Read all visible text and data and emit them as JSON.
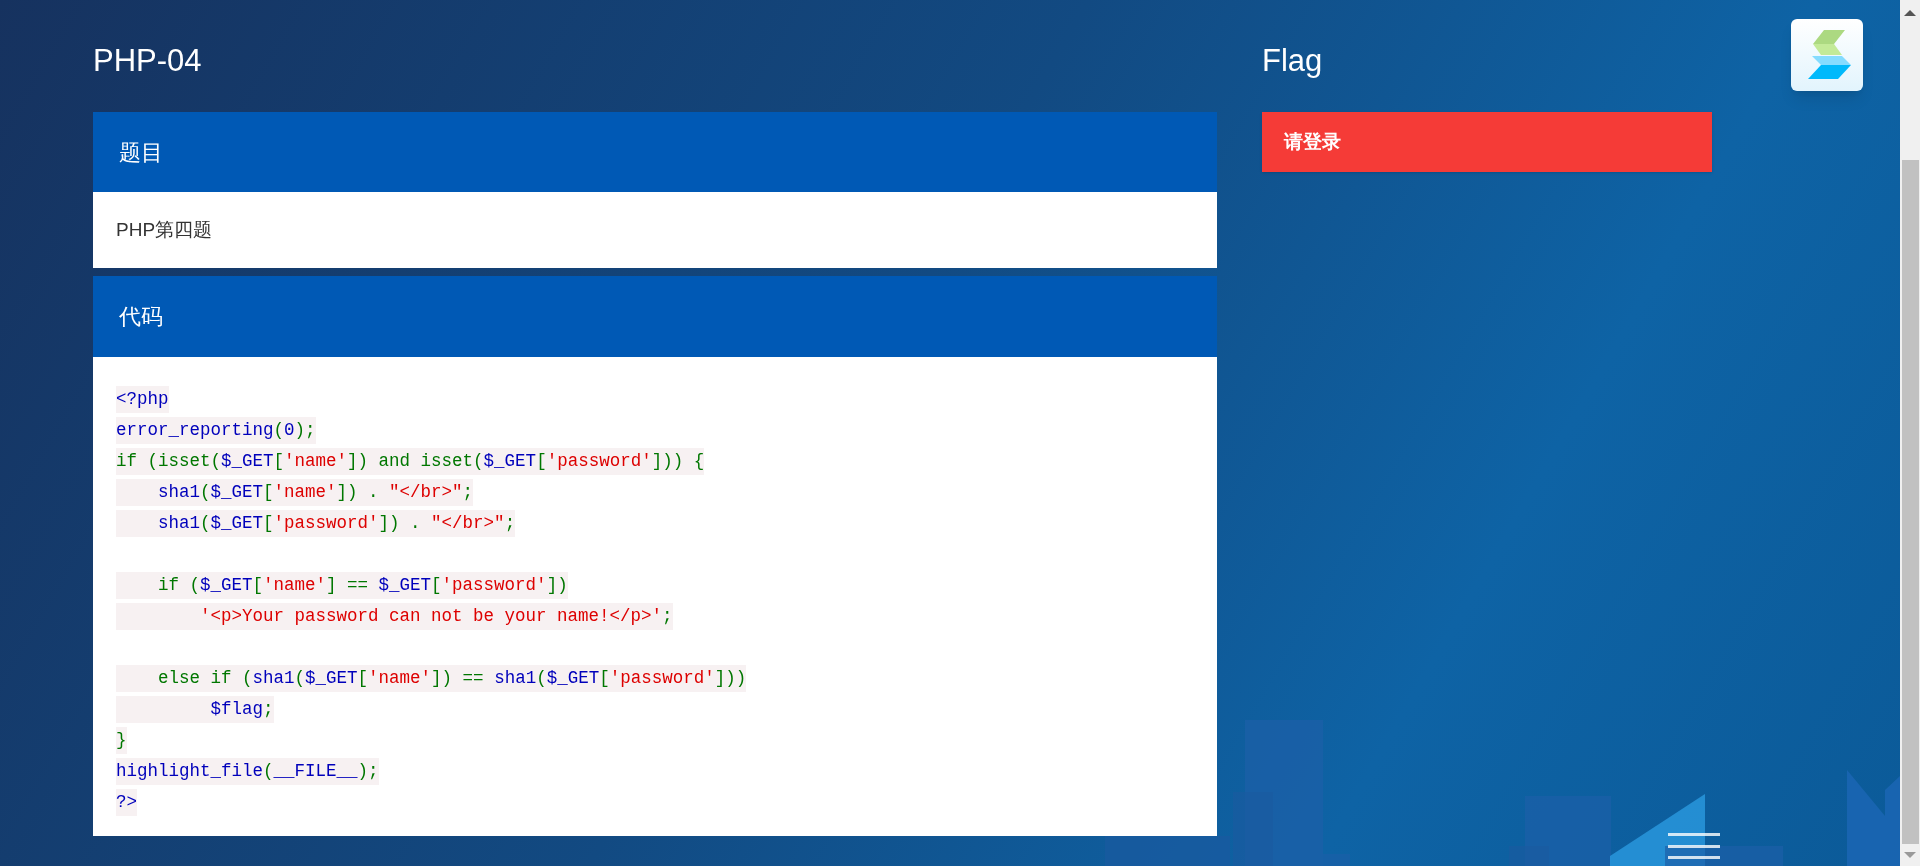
{
  "title": "PHP-04",
  "question": {
    "header": "题目",
    "body": "PHP第四题"
  },
  "code": {
    "header": "代码",
    "lines": [
      {
        "kind": "code",
        "tokens": [
          {
            "kind": "default",
            "text": "<?php"
          }
        ]
      },
      {
        "kind": "code",
        "tokens": [
          {
            "kind": "default",
            "text": "error_reporting"
          },
          {
            "kind": "keyword",
            "text": "("
          },
          {
            "kind": "default",
            "text": "0"
          },
          {
            "kind": "keyword",
            "text": ");"
          }
        ]
      },
      {
        "kind": "code",
        "tokens": [
          {
            "kind": "keyword",
            "text": "if (isset("
          },
          {
            "kind": "default",
            "text": "$_GET"
          },
          {
            "kind": "keyword",
            "text": "["
          },
          {
            "kind": "string",
            "text": "'name'"
          },
          {
            "kind": "keyword",
            "text": "]) and isset("
          },
          {
            "kind": "default",
            "text": "$_GET"
          },
          {
            "kind": "keyword",
            "text": "["
          },
          {
            "kind": "string",
            "text": "'password'"
          },
          {
            "kind": "keyword",
            "text": "])) {"
          }
        ]
      },
      {
        "kind": "code",
        "tokens": [
          {
            "kind": "default",
            "text": "    sha1"
          },
          {
            "kind": "keyword",
            "text": "("
          },
          {
            "kind": "default",
            "text": "$_GET"
          },
          {
            "kind": "keyword",
            "text": "["
          },
          {
            "kind": "string",
            "text": "'name'"
          },
          {
            "kind": "keyword",
            "text": "]) . "
          },
          {
            "kind": "string",
            "text": "\"</br>\""
          },
          {
            "kind": "keyword",
            "text": ";"
          }
        ]
      },
      {
        "kind": "code",
        "tokens": [
          {
            "kind": "default",
            "text": "    sha1"
          },
          {
            "kind": "keyword",
            "text": "("
          },
          {
            "kind": "default",
            "text": "$_GET"
          },
          {
            "kind": "keyword",
            "text": "["
          },
          {
            "kind": "string",
            "text": "'password'"
          },
          {
            "kind": "keyword",
            "text": "]) . "
          },
          {
            "kind": "string",
            "text": "\"</br>\""
          },
          {
            "kind": "keyword",
            "text": ";"
          }
        ]
      },
      {
        "kind": "blank"
      },
      {
        "kind": "code",
        "tokens": [
          {
            "kind": "keyword",
            "text": "    if ("
          },
          {
            "kind": "default",
            "text": "$_GET"
          },
          {
            "kind": "keyword",
            "text": "["
          },
          {
            "kind": "string",
            "text": "'name'"
          },
          {
            "kind": "keyword",
            "text": "] == "
          },
          {
            "kind": "default",
            "text": "$_GET"
          },
          {
            "kind": "keyword",
            "text": "["
          },
          {
            "kind": "string",
            "text": "'password'"
          },
          {
            "kind": "keyword",
            "text": "])"
          }
        ]
      },
      {
        "kind": "code",
        "tokens": [
          {
            "kind": "string",
            "text": "        '<p>Your password can not be your name!</p>'"
          },
          {
            "kind": "keyword",
            "text": ";"
          }
        ]
      },
      {
        "kind": "blank"
      },
      {
        "kind": "code",
        "tokens": [
          {
            "kind": "keyword",
            "text": "    else if ("
          },
          {
            "kind": "default",
            "text": "sha1"
          },
          {
            "kind": "keyword",
            "text": "("
          },
          {
            "kind": "default",
            "text": "$_GET"
          },
          {
            "kind": "keyword",
            "text": "["
          },
          {
            "kind": "string",
            "text": "'name'"
          },
          {
            "kind": "keyword",
            "text": "]) == "
          },
          {
            "kind": "default",
            "text": "sha1"
          },
          {
            "kind": "keyword",
            "text": "("
          },
          {
            "kind": "default",
            "text": "$_GET"
          },
          {
            "kind": "keyword",
            "text": "["
          },
          {
            "kind": "string",
            "text": "'password'"
          },
          {
            "kind": "keyword",
            "text": "]))"
          }
        ]
      },
      {
        "kind": "code",
        "tokens": [
          {
            "kind": "default",
            "text": "         $flag"
          },
          {
            "kind": "keyword",
            "text": ";"
          }
        ]
      },
      {
        "kind": "code",
        "tokens": [
          {
            "kind": "keyword",
            "text": "}"
          }
        ]
      },
      {
        "kind": "code",
        "tokens": [
          {
            "kind": "default",
            "text": "highlight_file"
          },
          {
            "kind": "keyword",
            "text": "("
          },
          {
            "kind": "default",
            "text": "__FILE__"
          },
          {
            "kind": "keyword",
            "text": ");"
          }
        ]
      },
      {
        "kind": "code",
        "tokens": [
          {
            "kind": "default",
            "text": "?>"
          }
        ]
      }
    ]
  },
  "flag": {
    "title": "Flag",
    "notice": "请登录"
  }
}
